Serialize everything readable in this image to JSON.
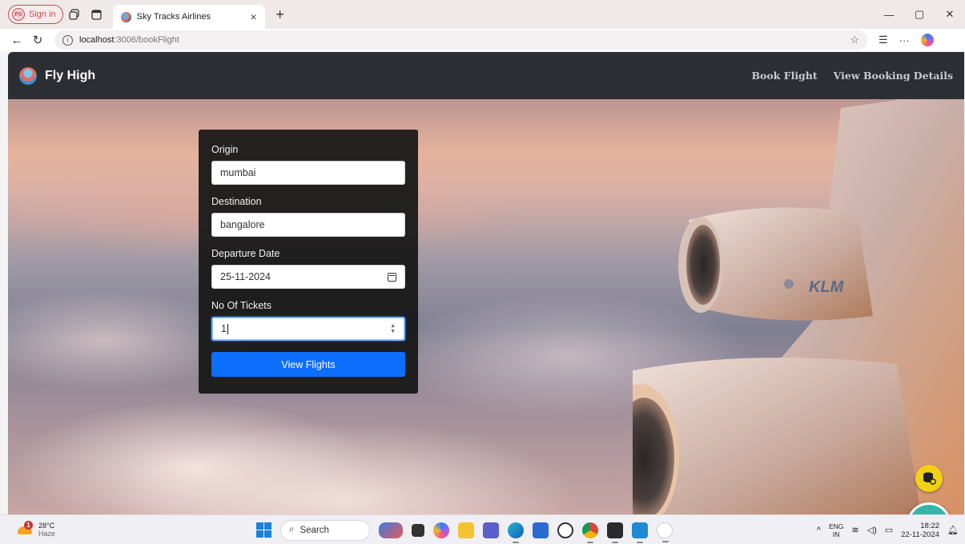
{
  "browser": {
    "profile_initials": "PS",
    "profile_label": "Sign in",
    "tab_title": "Sky Tracks Airlines",
    "url_host": "localhost",
    "url_path": ":3006/bookFlight"
  },
  "navbar": {
    "brand": "Fly High",
    "links": [
      "Book Flight",
      "View Booking Details"
    ]
  },
  "form": {
    "origin_label": "Origin",
    "origin_value": "mumbai",
    "destination_label": "Destination",
    "destination_value": "bangalore",
    "date_label": "Departure Date",
    "date_value": "25-11-2024",
    "tickets_label": "No Of Tickets",
    "tickets_value": "1",
    "submit_label": "View Flights"
  },
  "airplane_text": "KLM",
  "taskbar": {
    "temperature": "28°C",
    "weather": "Haze",
    "weather_badge": "1",
    "search_label": "Search",
    "lang_top": "ENG",
    "lang_bottom": "IN",
    "time": "18:22",
    "date": "22-11-2024"
  },
  "colors": {
    "navbar": "#2b2f33",
    "primary_button": "#0d6efd",
    "card": "#161616",
    "db_fab": "#f2d114",
    "tools_fab": "#35b5a8"
  }
}
